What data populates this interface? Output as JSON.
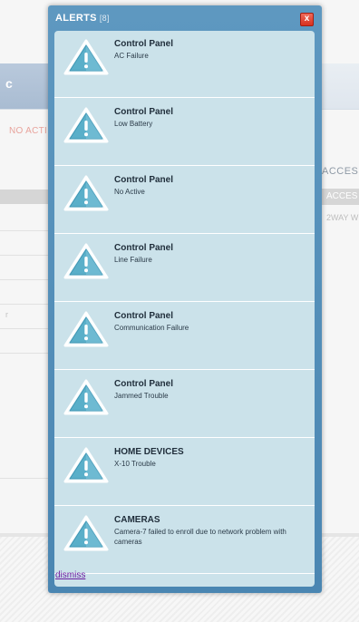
{
  "background": {
    "tab_label": "c",
    "status_text": "NO ACTI",
    "side_letter": "r",
    "accessories_title": "ACCESSO",
    "accessories_header": "ACCES",
    "accessories_cell": "2WAY W"
  },
  "modal": {
    "title": "ALERTS",
    "count": "[8]",
    "close_glyph": "x",
    "dismiss_label": "dismiss"
  },
  "alerts": [
    {
      "title": "Control Panel",
      "message": "AC Failure"
    },
    {
      "title": "Control Panel",
      "message": "Low Battery"
    },
    {
      "title": "Control Panel",
      "message": "No Active"
    },
    {
      "title": "Control Panel",
      "message": "Line Failure"
    },
    {
      "title": "Control Panel",
      "message": "Communication Failure"
    },
    {
      "title": "Control Panel",
      "message": "Jammed Trouble"
    },
    {
      "title": "HOME DEVICES",
      "message": "X-10 Trouble"
    },
    {
      "title": "CAMERAS",
      "message": "Camera-7 failed to enroll due to network problem with cameras"
    }
  ],
  "colors": {
    "modal_frame": "#4a86b2",
    "modal_body": "#cbe2ea",
    "close_button": "#d8311f",
    "icon_fill": "#5aafc9",
    "dismiss_link": "#6a1aa0"
  },
  "icons": {
    "alert": "warning-triangle-icon",
    "close": "close-icon"
  }
}
